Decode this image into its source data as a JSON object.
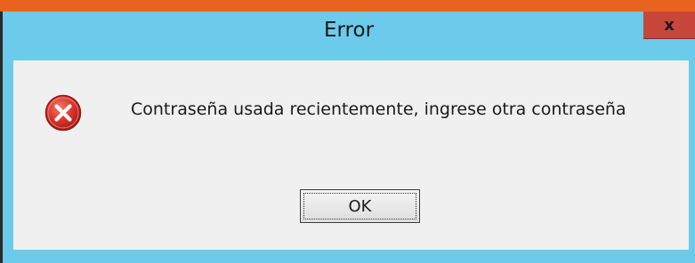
{
  "window": {
    "title": "Error",
    "close_label": "x"
  },
  "message": {
    "text": "Contraseña usada recientemente, ingrese otra contraseña",
    "icon": "error-icon"
  },
  "buttons": {
    "ok_label": "OK"
  },
  "colors": {
    "titlebar": "#6ccaeb",
    "close_button": "#c8463a",
    "client_background": "#f0f0f0",
    "top_strip": "#e8641e"
  }
}
